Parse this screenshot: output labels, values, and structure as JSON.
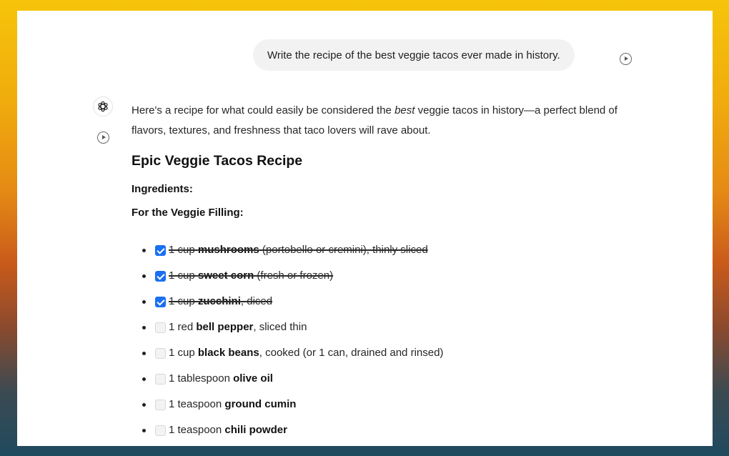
{
  "user_message": "Write the recipe of the best veggie tacos ever made in history.",
  "assistant": {
    "intro_before": "Here's a recipe for what could easily be considered the ",
    "intro_emphasis": "best",
    "intro_after": " veggie tacos in history—a perfect blend of flavors, textures, and freshness that taco lovers will rave about.",
    "recipe_title": "Epic Veggie Tacos Recipe",
    "ingredients_label": "Ingredients:",
    "filling_label": "For the Veggie Filling:",
    "items": [
      {
        "pre": "1 cup ",
        "bold": "mushrooms",
        "post": " (portobello or cremini), thinly sliced",
        "checked": true
      },
      {
        "pre": "1 cup ",
        "bold": "sweet corn",
        "post": " (fresh or frozen)",
        "checked": true
      },
      {
        "pre": "1 cup ",
        "bold": "zucchini",
        "post": ", diced",
        "checked": true
      },
      {
        "pre": "1 red ",
        "bold": "bell pepper",
        "post": ", sliced thin",
        "checked": false
      },
      {
        "pre": "1 cup ",
        "bold": "black beans",
        "post": ", cooked (or 1 can, drained and rinsed)",
        "checked": false
      },
      {
        "pre": "1 tablespoon ",
        "bold": "olive oil",
        "post": "",
        "checked": false
      },
      {
        "pre": "1 teaspoon ",
        "bold": "ground cumin",
        "post": "",
        "checked": false
      },
      {
        "pre": "1 teaspoon ",
        "bold": "chili powder",
        "post": "",
        "checked": false
      }
    ]
  },
  "icons": {
    "play_user": "play-circle-icon",
    "play_assistant": "play-circle-icon",
    "avatar": "openai-logo-icon",
    "checkbox_checked": "checkmark-icon"
  },
  "colors": {
    "checkbox_accent": "#1a6ff2",
    "bubble_bg": "#f2f2f2",
    "background_top": "#f6c40a",
    "background_bottom": "#1f4a5e"
  }
}
